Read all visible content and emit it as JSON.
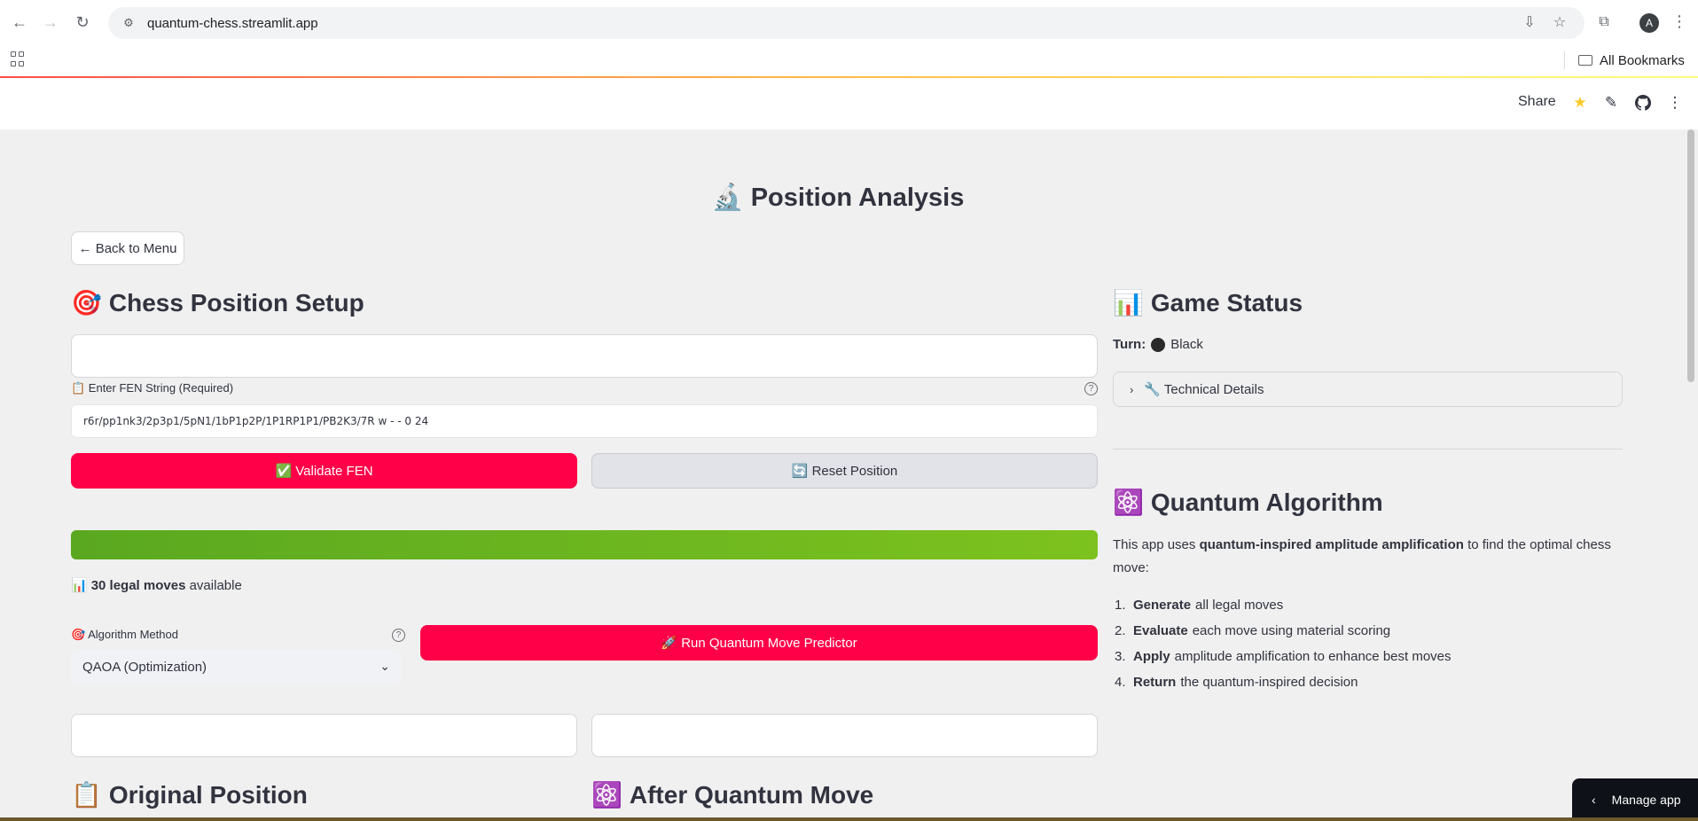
{
  "browser": {
    "url": "quantum-chess.streamlit.app",
    "bookmarks_label": "All Bookmarks",
    "avatar_letter": "A"
  },
  "header": {
    "share_label": "Share"
  },
  "page": {
    "title_emoji": "🔬",
    "title": "Position Analysis",
    "back_button": "← Back to Menu"
  },
  "setup": {
    "heading_emoji": "🎯",
    "heading": "Chess Position Setup",
    "fen_label": "📋 Enter FEN String (Required)",
    "fen_value": "r6r/pp1nk3/2p3p1/5pN1/1bP1p2P/1P1RP1P1/PB2K3/7R w - - 0 24",
    "validate_label": "✅ Validate FEN",
    "reset_label": "🔄 Reset Position",
    "progress_percent": 100,
    "legal_moves_emoji": "📊",
    "legal_moves_bold": "30 legal moves",
    "legal_moves_suffix": " available",
    "algo_label": "🎯 Algorithm Method",
    "algo_selected": "QAOA (Optimization)",
    "run_label": "🚀 Run Quantum Move Predictor"
  },
  "boards": {
    "original_emoji": "📋",
    "original_heading": "Original Position",
    "after_emoji": "⚛️",
    "after_heading": "After Quantum Move"
  },
  "status": {
    "heading_emoji": "📊",
    "heading": "Game Status",
    "turn_label": "Turn:",
    "turn_value": "Black",
    "technical_label": "🔧 Technical Details"
  },
  "algorithm": {
    "heading_emoji": "⚛️",
    "heading": "Quantum Algorithm",
    "intro_prefix": "This app uses ",
    "intro_bold": "quantum-inspired amplitude amplification",
    "intro_suffix": " to find the optimal chess move:",
    "steps": [
      {
        "num": "1.",
        "bold": "Generate",
        "text": "all legal moves"
      },
      {
        "num": "2.",
        "bold": "Evaluate",
        "text": "each move using material scoring"
      },
      {
        "num": "3.",
        "bold": "Apply",
        "text": "amplitude amplification to enhance best moves"
      },
      {
        "num": "4.",
        "bold": "Return",
        "text": "the quantum-inspired decision"
      }
    ]
  },
  "manage_app": "Manage app"
}
